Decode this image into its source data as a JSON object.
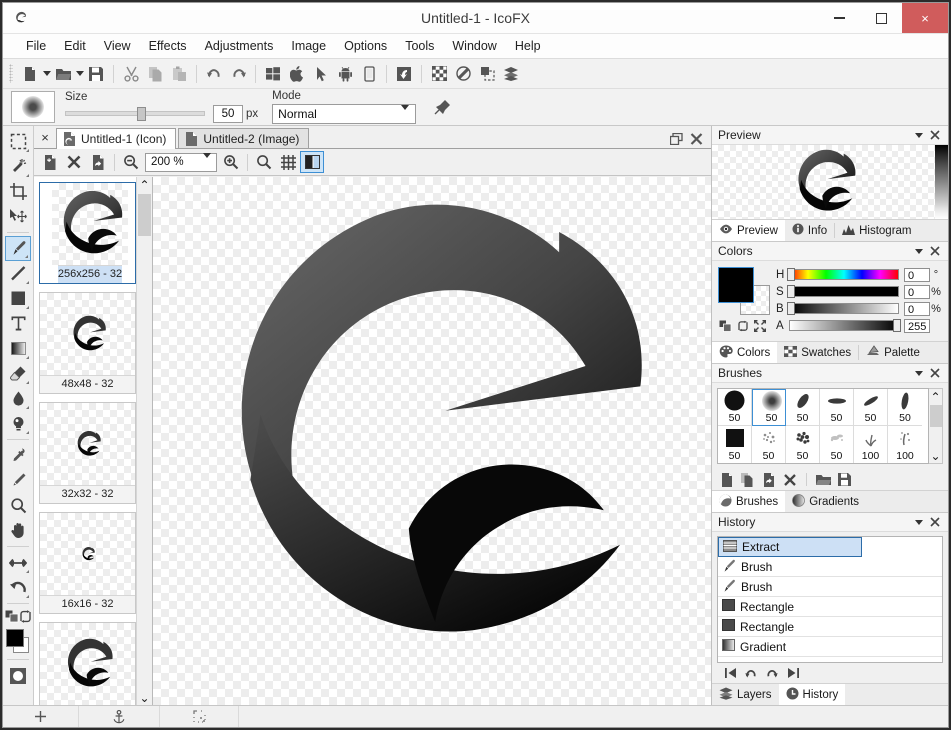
{
  "window": {
    "title": "Untitled-1 - IcoFX",
    "app_icon": "icofx-logo-icon",
    "minimize_label": "minimize",
    "maximize_label": "maximize",
    "close_label": "close",
    "close_glyph": "×",
    "accent_close": "#d05c5c",
    "accent_select": "#cde4f7",
    "accent_border": "#3d8fd4"
  },
  "menu": {
    "items": [
      {
        "label": "File"
      },
      {
        "label": "Edit"
      },
      {
        "label": "View"
      },
      {
        "label": "Effects"
      },
      {
        "label": "Adjustments"
      },
      {
        "label": "Image"
      },
      {
        "label": "Options"
      },
      {
        "label": "Tools"
      },
      {
        "label": "Window"
      },
      {
        "label": "Help"
      }
    ]
  },
  "toolbar": {
    "items": [
      {
        "name": "new-document-icon",
        "has_dropdown": true
      },
      {
        "name": "open-folder-icon",
        "has_dropdown": true
      },
      {
        "name": "save-icon",
        "has_dropdown": false
      },
      {
        "name": "cut-icon",
        "has_dropdown": false
      },
      {
        "name": "copy-icon",
        "has_dropdown": false
      },
      {
        "name": "paste-icon",
        "has_dropdown": false
      },
      {
        "name": "undo-icon",
        "has_dropdown": false
      },
      {
        "name": "redo-icon",
        "has_dropdown": false
      },
      {
        "name": "windows-icon",
        "has_dropdown": false
      },
      {
        "name": "apple-icon",
        "has_dropdown": false
      },
      {
        "name": "cursor-icon",
        "has_dropdown": false
      },
      {
        "name": "android-icon",
        "has_dropdown": false
      },
      {
        "name": "mobile-icon",
        "has_dropdown": false
      },
      {
        "name": "extract-icon",
        "has_dropdown": false
      },
      {
        "name": "transparency-icon",
        "has_dropdown": false
      },
      {
        "name": "opacity-icon",
        "has_dropdown": false
      },
      {
        "name": "selection-icon",
        "has_dropdown": false
      },
      {
        "name": "layers-icon",
        "has_dropdown": false
      }
    ]
  },
  "options": {
    "brush_preview_name": "brush-preview-swatch",
    "size_label": "Size",
    "size_value": "50",
    "size_unit": "px",
    "mode_label": "Mode",
    "mode_value": "Normal",
    "mode_options": [
      "Normal"
    ],
    "pin_icon": "pin-options-icon"
  },
  "tools": {
    "items": [
      {
        "name": "rectangular-marquee-tool",
        "label": "Rectangular Marquee",
        "active": false,
        "corner": true
      },
      {
        "name": "magic-wand-tool",
        "label": "Magic Wand",
        "active": false,
        "corner": true
      },
      {
        "name": "crop-tool",
        "label": "Crop",
        "active": false,
        "corner": false
      },
      {
        "name": "move-tool",
        "label": "Move",
        "active": false,
        "corner": false
      },
      {
        "name": "brush-tool",
        "label": "Brush",
        "active": true,
        "corner": true
      },
      {
        "name": "line-tool",
        "label": "Line",
        "active": false,
        "corner": true
      },
      {
        "name": "rectangle-tool",
        "label": "Rectangle",
        "active": false,
        "corner": true
      },
      {
        "name": "text-tool",
        "label": "Text",
        "active": false,
        "corner": false
      },
      {
        "name": "gradient-tool",
        "label": "Gradient",
        "active": false,
        "corner": true
      },
      {
        "name": "eraser-tool",
        "label": "Eraser",
        "active": false,
        "corner": true
      },
      {
        "name": "blur-tool",
        "label": "Blur",
        "active": false,
        "corner": true
      },
      {
        "name": "dodge-tool",
        "label": "Dodge",
        "active": false,
        "corner": true
      },
      {
        "name": "eyedropper-tool",
        "label": "Color Picker",
        "active": false,
        "corner": false
      },
      {
        "name": "pencil-tool",
        "label": "Pencil",
        "active": false,
        "corner": false
      },
      {
        "name": "zoom-tool",
        "label": "Zoom",
        "active": false,
        "corner": false
      },
      {
        "name": "hand-tool",
        "label": "Hand",
        "active": false,
        "corner": false
      },
      {
        "name": "flip-tool",
        "label": "Flip",
        "active": false,
        "corner": true
      },
      {
        "name": "rotate-tool",
        "label": "Rotate",
        "active": false,
        "corner": true
      }
    ],
    "swap_colors_icon": "swap-colors-icon",
    "reset_colors_icon": "reset-colors-icon",
    "foreground_color": "#000000",
    "background_color": "#ffffff",
    "quick_mask_icon": "quick-mask-icon"
  },
  "document": {
    "close_glyph": "×",
    "tabs": [
      {
        "label": "Untitled-1 (Icon)",
        "icon": "icon-document-icon",
        "active": true
      },
      {
        "label": "Untitled-2 (Image)",
        "icon": "image-document-icon",
        "active": false
      }
    ],
    "restore_icon": "restore-document-icon",
    "close_icon": "close-document-icon",
    "subtoolbar": {
      "new_image_icon": "add-image-icon",
      "delete_image_icon": "delete-image-icon",
      "export_image_icon": "export-image-icon",
      "zoom_out_icon": "zoom-out-icon",
      "zoom_value": "200 %",
      "zoom_options": [
        "200 %"
      ],
      "zoom_in_icon": "zoom-in-icon",
      "zoom_fit_icon": "zoom-fit-icon",
      "grid_icon": "grid-icon",
      "split_view_icon": "split-view-icon"
    },
    "images": [
      {
        "caption": "256x256 - 32",
        "selected": true,
        "scale": 1.0
      },
      {
        "caption": "48x48 - 32",
        "selected": false,
        "scale": 0.45
      },
      {
        "caption": "32x32 - 32",
        "selected": false,
        "scale": 0.32
      },
      {
        "caption": "16x16 - 32",
        "selected": false,
        "scale": 0.16
      },
      {
        "caption": "",
        "selected": false,
        "scale": 0.75
      }
    ],
    "scroll_up_glyph": "⌃",
    "scroll_down_glyph": "⌄"
  },
  "preview": {
    "title": "Preview",
    "collapse_icon": "chevron-down-icon",
    "close_icon": "close-panel-icon",
    "tabs": [
      {
        "label": "Preview",
        "icon": "eye-icon",
        "active": true
      },
      {
        "label": "Info",
        "icon": "info-icon",
        "active": false
      },
      {
        "label": "Histogram",
        "icon": "histogram-icon",
        "active": false
      }
    ]
  },
  "colors": {
    "title": "Colors",
    "collapse_icon": "chevron-down-icon",
    "close_icon": "close-panel-icon",
    "foreground": "#000000",
    "background": "#ffffff",
    "tool_icons": [
      "duplicate-color-icon",
      "swap-color-icon",
      "expand-color-icon"
    ],
    "channels": [
      {
        "label": "H",
        "value": "0",
        "unit": "°",
        "thumb_pct": 0
      },
      {
        "label": "S",
        "value": "0",
        "unit": "%",
        "thumb_pct": 0
      },
      {
        "label": "B",
        "value": "0",
        "unit": "%",
        "thumb_pct": 0
      },
      {
        "label": "A",
        "value": "255",
        "unit": "",
        "thumb_pct": 100
      }
    ],
    "tabs": [
      {
        "label": "Colors",
        "icon": "palette-colors-icon",
        "active": true
      },
      {
        "label": "Swatches",
        "icon": "swatches-icon",
        "active": false
      },
      {
        "label": "Palette",
        "icon": "palette-icon",
        "active": false
      }
    ]
  },
  "brushes": {
    "title": "Brushes",
    "collapse_icon": "chevron-down-icon",
    "close_icon": "close-panel-icon",
    "items": [
      {
        "size": "50",
        "shape": "hard-round",
        "selected": false
      },
      {
        "size": "50",
        "shape": "soft-round",
        "selected": true
      },
      {
        "size": "50",
        "shape": "angled-blob",
        "selected": false
      },
      {
        "size": "50",
        "shape": "flat-oval",
        "selected": false
      },
      {
        "size": "50",
        "shape": "slanted-stroke",
        "selected": false
      },
      {
        "size": "50",
        "shape": "vertical-blob",
        "selected": false
      },
      {
        "size": "50",
        "shape": "hard-square",
        "selected": false
      },
      {
        "size": "50",
        "shape": "spatter-light",
        "selected": false
      },
      {
        "size": "50",
        "shape": "spatter-dense",
        "selected": false
      },
      {
        "size": "50",
        "shape": "scatter-faint",
        "selected": false
      },
      {
        "size": "100",
        "shape": "grass",
        "selected": false
      },
      {
        "size": "100",
        "shape": "splash",
        "selected": false
      }
    ],
    "tool_icons": [
      "new-brush-icon",
      "duplicate-brush-icon",
      "edit-brush-icon",
      "delete-brush-icon",
      "load-brush-icon",
      "save-brush-icon"
    ],
    "tabs": [
      {
        "label": "Brushes",
        "icon": "brushes-icon",
        "active": true
      },
      {
        "label": "Gradients",
        "icon": "gradients-icon",
        "active": false
      }
    ],
    "scroll_up_glyph": "⌃",
    "scroll_down_glyph": "⌄"
  },
  "history": {
    "title": "History",
    "collapse_icon": "chevron-down-icon",
    "close_icon": "close-panel-icon",
    "items": [
      {
        "label": "Extract",
        "icon": "extract-history-icon",
        "selected": true
      },
      {
        "label": "Brush",
        "icon": "brush-history-icon",
        "selected": false
      },
      {
        "label": "Brush",
        "icon": "brush-history-icon",
        "selected": false
      },
      {
        "label": "Rectangle",
        "icon": "rectangle-history-icon",
        "selected": false
      },
      {
        "label": "Rectangle",
        "icon": "rectangle-history-icon",
        "selected": false
      },
      {
        "label": "Gradient",
        "icon": "gradient-history-icon",
        "selected": false
      }
    ],
    "nav_icons": [
      "first-step-icon",
      "step-back-icon",
      "step-forward-icon",
      "last-step-icon"
    ],
    "tabs": [
      {
        "label": "Layers",
        "icon": "layers-tab-icon",
        "active": false
      },
      {
        "label": "History",
        "icon": "history-clock-icon",
        "active": true
      }
    ]
  },
  "statusbar": {
    "cells": [
      {
        "name": "add-status-icon",
        "label": ""
      },
      {
        "name": "anchor-status-icon",
        "label": ""
      },
      {
        "name": "selection-status-icon",
        "label": ""
      },
      {
        "name": "status-message",
        "label": ""
      }
    ]
  }
}
